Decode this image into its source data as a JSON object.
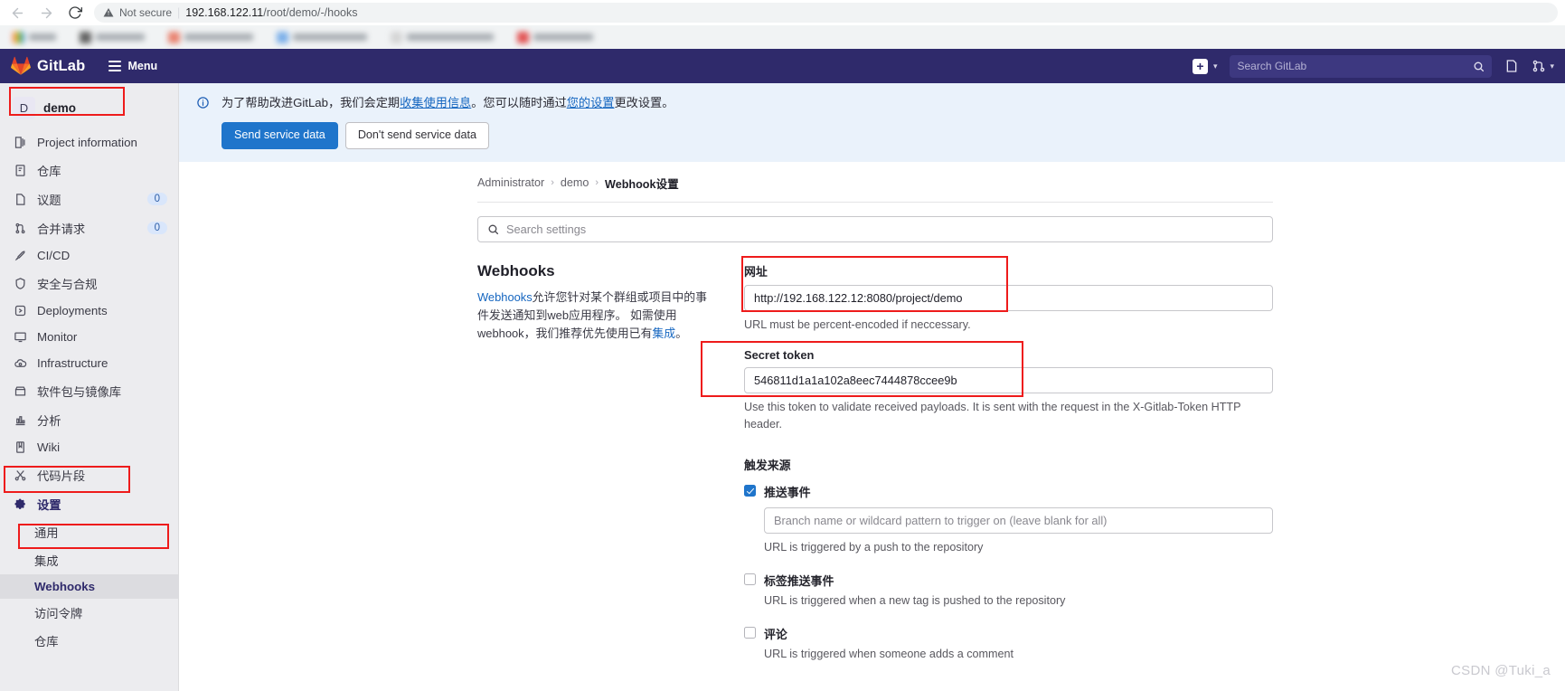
{
  "browser": {
    "back_icon": "arrow-left-icon",
    "forward_icon": "arrow-right-icon",
    "reload_icon": "reload-icon",
    "security_label": "Not secure",
    "url_host": "192.168.122.11",
    "url_path": "/root/demo/-/hooks"
  },
  "header": {
    "brand": "GitLab",
    "menu_label": "Menu",
    "search_placeholder": "Search GitLab",
    "colors": {
      "navy": "#2f2a6b",
      "search_bg": "#3d3880"
    }
  },
  "sidebar": {
    "project": {
      "initial": "D",
      "name": "demo"
    },
    "items": [
      {
        "label": "Project information",
        "icon": "project-information-icon",
        "badge": ""
      },
      {
        "label": "仓库",
        "icon": "repository-icon",
        "badge": ""
      },
      {
        "label": "议题",
        "icon": "issues-icon",
        "badge": "0"
      },
      {
        "label": "合并请求",
        "icon": "merge-requests-icon",
        "badge": "0"
      },
      {
        "label": "CI/CD",
        "icon": "cicd-rocket-icon",
        "badge": ""
      },
      {
        "label": "安全与合规",
        "icon": "shield-icon",
        "badge": ""
      },
      {
        "label": "Deployments",
        "icon": "deployments-icon",
        "badge": ""
      },
      {
        "label": "Monitor",
        "icon": "monitor-icon",
        "badge": ""
      },
      {
        "label": "Infrastructure",
        "icon": "infrastructure-cloud-icon",
        "badge": ""
      },
      {
        "label": "软件包与镜像库",
        "icon": "package-icon",
        "badge": ""
      },
      {
        "label": "分析",
        "icon": "analytics-chart-icon",
        "badge": ""
      },
      {
        "label": "Wiki",
        "icon": "wiki-book-icon",
        "badge": ""
      },
      {
        "label": "代码片段",
        "icon": "snippets-scissors-icon",
        "badge": ""
      },
      {
        "label": "设置",
        "icon": "settings-gear-icon",
        "badge": ""
      }
    ],
    "settings_children": [
      {
        "label": "通用"
      },
      {
        "label": "集成"
      },
      {
        "label": "Webhooks"
      },
      {
        "label": "访问令牌"
      },
      {
        "label": "仓库"
      }
    ]
  },
  "alert": {
    "icon": "info-circle-icon",
    "text_1": "为了帮助改进GitLab，我们会定期",
    "link_1": "收集使用信息",
    "text_2": "。您可以随时通过",
    "link_2": "您的设置",
    "text_3": "更改设置。",
    "primary_button": "Send service data",
    "secondary_button": "Don't send service data"
  },
  "breadcrumb": {
    "items": [
      "Administrator",
      "demo"
    ],
    "current": "Webhook设置",
    "separator": "›"
  },
  "settings_search": {
    "icon": "search-icon",
    "placeholder": "Search settings"
  },
  "webhooks": {
    "title": "Webhooks",
    "desc_link": "Webhooks",
    "desc_text": "允许您针对某个群组或项目中的事件发送通知到web应用程序。 如需使用webhook，我们推荐优先使用已有",
    "desc_link_2": "集成",
    "desc_end": "。",
    "url_field": {
      "label": "网址",
      "value": "http://192.168.122.12:8080/project/demo",
      "help": "URL must be percent-encoded if neccessary."
    },
    "token_field": {
      "label": "Secret token",
      "value": "546811d1a1a102a8eec7444878ccee9b",
      "help": "Use this token to validate received payloads. It is sent with the request in the X-Gitlab-Token HTTP header."
    },
    "trigger_title": "触发来源",
    "triggers": [
      {
        "label": "推送事件",
        "checked": true,
        "branch_placeholder": "Branch name or wildcard pattern to trigger on (leave blank for all)",
        "help": "URL is triggered by a push to the repository"
      },
      {
        "label": "标签推送事件",
        "checked": false,
        "help": "URL is triggered when a new tag is pushed to the repository"
      },
      {
        "label": "评论",
        "checked": false,
        "help": "URL is triggered when someone adds a comment"
      }
    ]
  },
  "watermark": "CSDN @Tuki_a",
  "highlight_color": "#ee1b1b"
}
